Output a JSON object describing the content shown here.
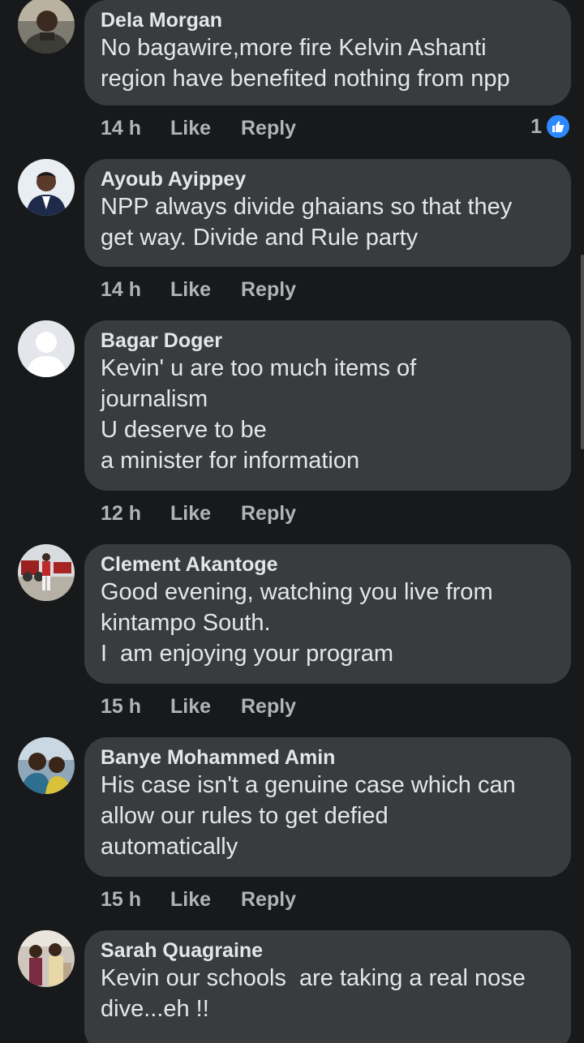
{
  "comments": [
    {
      "author": "Dela Morgan",
      "lines": [
        "No bagawire,more fire Kelvin Ashanti",
        "region have benefited nothing from npp"
      ],
      "time": "14 h",
      "like_label": "Like",
      "reply_label": "Reply",
      "reaction_count": "1"
    },
    {
      "author": "Ayoub Ayippey",
      "lines": [
        "NPP always divide ghaians so that they",
        "get way. Divide and Rule party"
      ],
      "time": "14 h",
      "like_label": "Like",
      "reply_label": "Reply"
    },
    {
      "author": "Bagar Doger",
      "lines": [
        "Kevin' u are too much items of",
        "journalism",
        "U deserve to be",
        "a minister for information"
      ],
      "time": "12 h",
      "like_label": "Like",
      "reply_label": "Reply"
    },
    {
      "author": "Clement Akantoge",
      "lines": [
        "Good evening, watching you live from",
        "kintampo South.",
        "I  am enjoying your program"
      ],
      "time": "15 h",
      "like_label": "Like",
      "reply_label": "Reply"
    },
    {
      "author": "Banye Mohammed Amin",
      "lines": [
        "His case isn't a genuine case which can",
        "allow our rules to get defied",
        "automatically"
      ],
      "time": "15 h",
      "like_label": "Like",
      "reply_label": "Reply"
    },
    {
      "author": "Sarah Quagraine",
      "lines": [
        "Kevin our schools  are taking a real nose",
        "dive...eh !!"
      ],
      "time": "",
      "like_label": "",
      "reply_label": ""
    }
  ],
  "icons": {
    "reaction": "like-thumbs-up-icon",
    "default_avatar": "default-user-avatar-icon"
  },
  "colors": {
    "background": "#18191a",
    "bubble": "#3a3b3c",
    "text": "#e4e6eb",
    "meta": "#b0b3b8",
    "like_blue": "#2d88ff"
  }
}
